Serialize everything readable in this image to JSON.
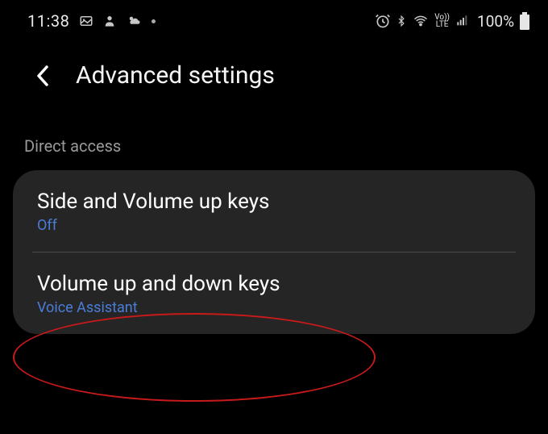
{
  "status": {
    "time": "11:38",
    "battery_percent": "100%"
  },
  "header": {
    "title": "Advanced settings"
  },
  "section": {
    "label": "Direct access"
  },
  "items": [
    {
      "title": "Side and Volume up keys",
      "sub": "Off"
    },
    {
      "title": "Volume up and down keys",
      "sub": "Voice Assistant"
    }
  ]
}
